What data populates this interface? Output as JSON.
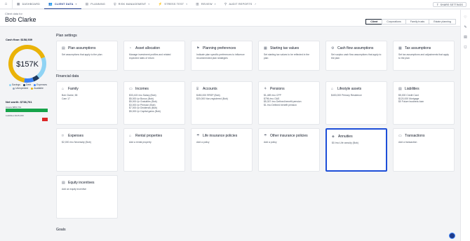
{
  "nav": {
    "items": [
      {
        "label": "DASHBOARD",
        "icon": "dashboard-icon",
        "glyph": "▦",
        "chevron": false,
        "active": false
      },
      {
        "label": "CLIENT DATA",
        "icon": "people-icon",
        "glyph": "👥",
        "chevron": true,
        "active": true
      },
      {
        "label": "PLANNING",
        "icon": "planning-icon",
        "glyph": "▤",
        "chevron": false,
        "active": false
      },
      {
        "label": "RISK MANAGEMENT",
        "icon": "shield-icon",
        "glyph": "⛨",
        "chevron": true,
        "active": false
      },
      {
        "label": "STRESS TEST",
        "icon": "stress-icon",
        "glyph": "⚡",
        "chevron": true,
        "active": false
      },
      {
        "label": "REVIEW",
        "icon": "review-icon",
        "glyph": "▥",
        "chevron": true,
        "active": false
      },
      {
        "label": "AUDIT REPORTS",
        "icon": "audit-icon",
        "glyph": "⚲",
        "chevron": false,
        "external": true,
        "active": false
      }
    ],
    "share_label": "SHARE SETTINGS"
  },
  "client": {
    "label": "Client data for",
    "name": "Bob Clarke"
  },
  "tabs": [
    "Client",
    "Corporations",
    "Family trusts",
    "Estate planning"
  ],
  "summary": {
    "cashflow_label": "Cash flow: $158,539",
    "donut_value": "$157K",
    "legend": [
      {
        "label": "Savings",
        "color": "#8fd3f4"
      },
      {
        "label": "Debt",
        "color": "#1e3a5f"
      },
      {
        "label": "Expenses",
        "color": "#3b82f6"
      },
      {
        "label": "Unexpected",
        "color": "#94a3b8"
      },
      {
        "label": "Available",
        "color": "#eab308"
      }
    ],
    "donut_colors": {
      "available": "#eab308",
      "savings": "#8fd3f4",
      "debt": "#1e3a5f",
      "expenses": "#3b82f6"
    },
    "networth_label": "Net worth: $738,761",
    "assets_label": "Assets $883,761",
    "liabilities_label": "Liabilities $145,000",
    "assets_color": "#16a34a",
    "liabilities_color": "#dc2626"
  },
  "sections": {
    "plan_settings": "Plan settings",
    "financial_data": "Financial data",
    "goals": "Goals"
  },
  "plan_cards": [
    {
      "title": "Plan assumptions",
      "icon": "document-icon",
      "glyph": "▤",
      "body": [
        "Set assumptions that apply to the plan"
      ]
    },
    {
      "title": "Asset allocation",
      "icon": "chart-icon",
      "glyph": "◔",
      "body": [
        "Manage investment profiles and related expected rates of return"
      ]
    },
    {
      "title": "Planning preferences",
      "icon": "preferences-icon",
      "glyph": "⚑",
      "body": [
        "Indicate plan specific preferences to influence recommended plan strategies"
      ]
    },
    {
      "title": "Starting tax values",
      "icon": "calculator-icon",
      "glyph": "▦",
      "body": [
        "Set starting tax values to be reflected in the plan"
      ]
    },
    {
      "title": "Cash flow assumptions",
      "icon": "gear-icon",
      "glyph": "⚙",
      "body": [
        "Set surplus cash flow assumptions that apply to the plan"
      ]
    },
    {
      "title": "Tax assumptions",
      "icon": "calculator-icon",
      "glyph": "▦",
      "body": [
        "Set tax assumptions and adjustments that apply to the plan"
      ]
    }
  ],
  "financial_cards": [
    {
      "title": "Family",
      "icon": "family-icon",
      "glyph": "⌂",
      "body": [
        "Bob Clarke, 58",
        "Cam 17"
      ]
    },
    {
      "title": "Incomes",
      "icon": "income-icon",
      "glyph": "▭",
      "body": [
        "$33,415 /mo Salary (Bob)",
        "$5,000 /yr Bonus (Bob)",
        "$5,000 /yr Gratuities (Bob)",
        "$3,000 /yr Pension (Bob)",
        "$7,000 /yr Dividends (Bob)",
        "$5,000 /yr Capital gains (Bob)"
      ]
    },
    {
      "title": "Accounts",
      "icon": "bank-icon",
      "glyph": "⌸",
      "body": [
        "$450,000 RRSP (Bob)",
        "$20,000 Non-registered (Bob)"
      ]
    },
    {
      "title": "Pensions",
      "icon": "pension-icon",
      "glyph": "⚘",
      "body": [
        "$1,489 /mo CPP",
        "$796 /mo OAS",
        "$5,307 /mo Defined benefit pension",
        "$1 /mo Defined benefit pension"
      ]
    },
    {
      "title": "Lifestyle assets",
      "icon": "house-icon",
      "glyph": "⌂",
      "body": [
        "$400,000 Primary Residence"
      ]
    },
    {
      "title": "Liabilities",
      "icon": "ledger-icon",
      "glyph": "▤",
      "body": [
        "$5,000 Credit Card",
        "$120,000 Mortgage",
        "$0 Future business loan"
      ]
    },
    {
      "title": "Expenses",
      "icon": "tag-icon",
      "glyph": "⌑",
      "body": [
        "$2,000 /mo Necessity (Bob)"
      ]
    },
    {
      "title": "Rental properties",
      "icon": "building-icon",
      "glyph": "⌂",
      "body": [
        "Add a rental property"
      ]
    },
    {
      "title": "Life insurance policies",
      "icon": "umbrella-icon",
      "glyph": "☂",
      "body": [
        "Add a policy"
      ]
    },
    {
      "title": "Other insurance policies",
      "icon": "umbrella-icon",
      "glyph": "☂",
      "body": [
        "Add a policy"
      ]
    },
    {
      "title": "Annuities",
      "icon": "annuity-icon",
      "glyph": "◈",
      "body": [
        "$0 /mo Life annuity (Bob)"
      ],
      "selected": true
    },
    {
      "title": "Transactions",
      "icon": "transaction-icon",
      "glyph": "▭",
      "body": [
        "Add a transaction"
      ]
    },
    {
      "title": "Equity incentives",
      "icon": "equity-icon",
      "glyph": "▤",
      "body": [
        "Add an equity incentive"
      ]
    }
  ]
}
